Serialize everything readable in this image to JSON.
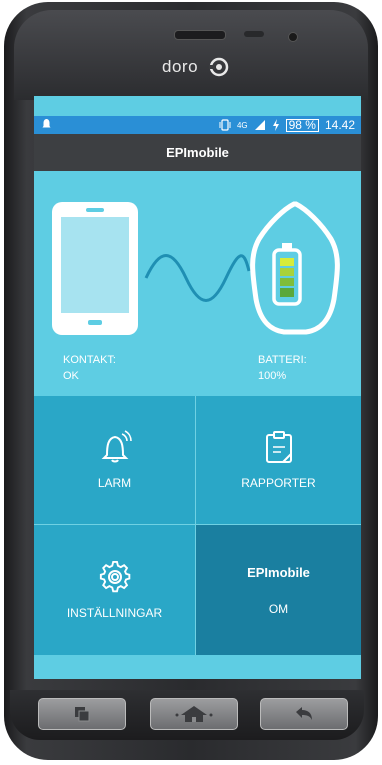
{
  "device": {
    "brand": "doro"
  },
  "status_bar": {
    "network": "4G",
    "battery_percent": "98 %",
    "time": "14.42"
  },
  "app_bar": {
    "title": "EPImobile"
  },
  "status": {
    "contact_label": "KONTAKT:",
    "contact_value": "OK",
    "battery_label": "BATTERI:",
    "battery_value": "100%"
  },
  "tiles": {
    "alarm_label": "LARM",
    "reports_label": "RAPPORTER",
    "settings_label": "INSTÄLLNINGAR",
    "about_title": "EPImobile",
    "about_label": "OM"
  },
  "colors": {
    "screen_bg": "#5ecde3",
    "tile_light": "#2aa7c7",
    "tile_dark": "#1a7fa0",
    "status_bar": "#2a8fd6",
    "app_bar": "#3d3f42"
  }
}
